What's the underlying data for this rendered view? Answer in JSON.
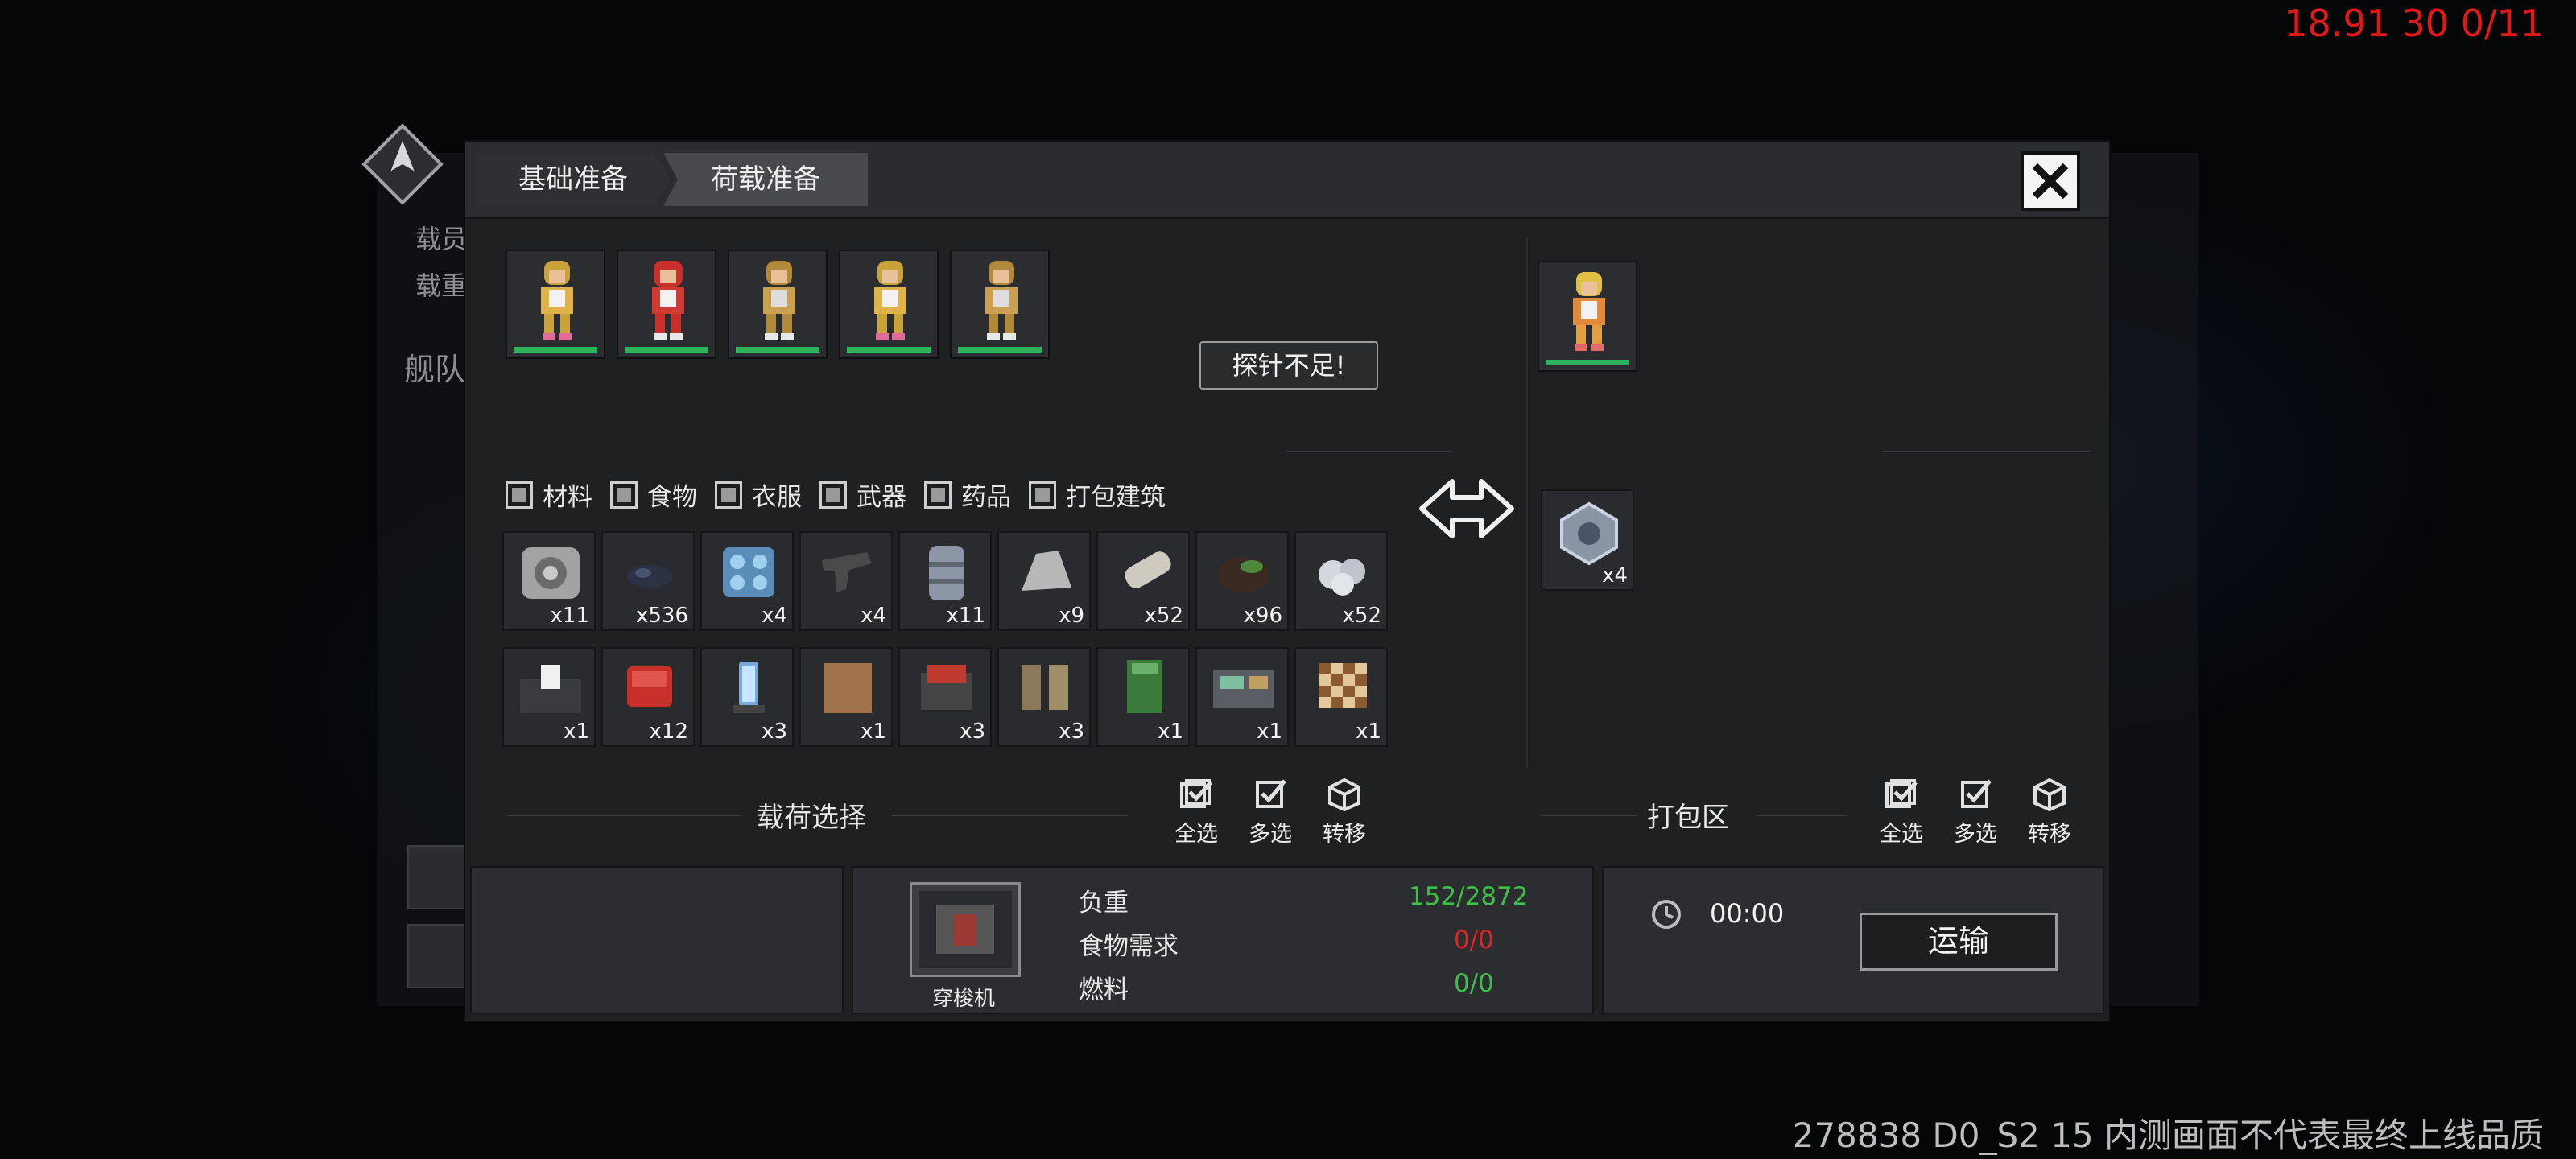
{
  "debug_text": "18.91 30 0/11",
  "watermark": "278838 D0_S2 15  内测画面不代表最终上线品质",
  "background": {
    "label_crew": "载员",
    "label_weight": "载重",
    "label_fleet": "舰队"
  },
  "tabs": {
    "basic": "基础准备",
    "load": "荷载准备"
  },
  "warning": "探针不足!",
  "filters": [
    "材料",
    "食物",
    "衣服",
    "武器",
    "药品",
    "打包建筑"
  ],
  "items": [
    {
      "icon": "engine-part-icon",
      "qty": "x11"
    },
    {
      "icon": "coal-icon",
      "qty": "x536"
    },
    {
      "icon": "solar-panel-icon",
      "qty": "x4"
    },
    {
      "icon": "pistol-icon",
      "qty": "x4"
    },
    {
      "icon": "barrel-icon",
      "qty": "x11"
    },
    {
      "icon": "stone-icon",
      "qty": "x9"
    },
    {
      "icon": "canister-icon",
      "qty": "x52"
    },
    {
      "icon": "ore-icon",
      "qty": "x96"
    },
    {
      "icon": "silver-ore-icon",
      "qty": "x52"
    },
    {
      "icon": "toilet-icon",
      "qty": "x1"
    },
    {
      "icon": "red-chair-icon",
      "qty": "x12"
    },
    {
      "icon": "lamp-icon",
      "qty": "x3"
    },
    {
      "icon": "wood-board-icon",
      "qty": "x1"
    },
    {
      "icon": "red-machine-icon",
      "qty": "x3"
    },
    {
      "icon": "boots-icon",
      "qty": "x3"
    },
    {
      "icon": "green-bed-icon",
      "qty": "x1"
    },
    {
      "icon": "console-icon",
      "qty": "x1"
    },
    {
      "icon": "chessboard-icon",
      "qty": "x1"
    }
  ],
  "cargo_zone": {
    "label": "载荷选择",
    "select_all": "全选",
    "multi_select": "多选",
    "transfer": "转移"
  },
  "pack_zone": {
    "label": "打包区",
    "select_all": "全选",
    "multi_select": "多选",
    "transfer": "转移",
    "item_qty": "x4"
  },
  "ship": {
    "name": "穿梭机",
    "load_label": "负重",
    "load_value": "152/2872",
    "food_label": "食物需求",
    "food_value": "0/0",
    "fuel_label": "燃料",
    "fuel_value": "0/0"
  },
  "timer": "00:00",
  "transport_button": "运输",
  "colors": {
    "ok_green": "#3fbf4a",
    "bad_red": "#e02424",
    "health_bar": "#2fb35f"
  }
}
